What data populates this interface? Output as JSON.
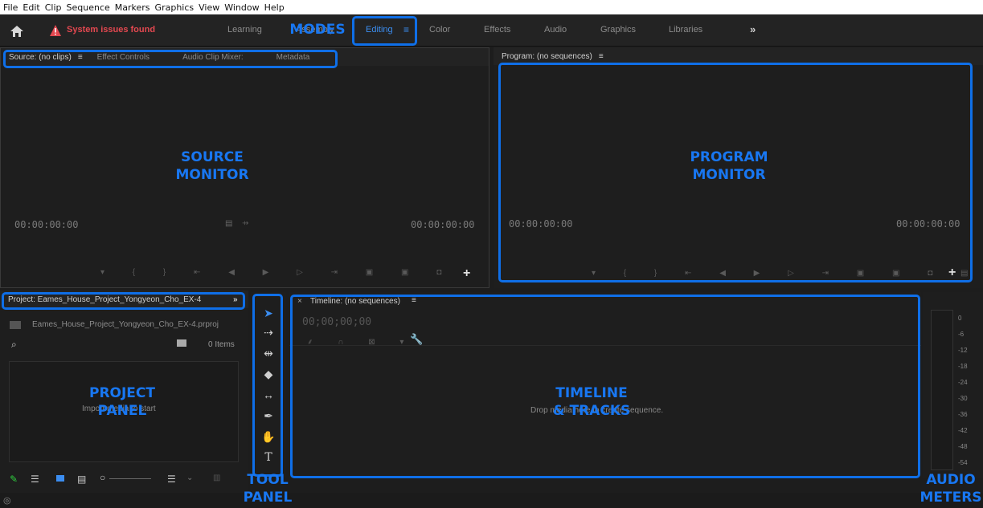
{
  "menu": [
    "File",
    "Edit",
    "Clip",
    "Sequence",
    "Markers",
    "Graphics",
    "View",
    "Window",
    "Help"
  ],
  "header": {
    "home_icon": "home-icon",
    "warning_text": "System issues found",
    "workspaces": [
      "Learning",
      "Assembly",
      "Editing",
      "Color",
      "Effects",
      "Audio",
      "Graphics",
      "Libraries"
    ],
    "active_workspace": "Editing",
    "overflow": "»"
  },
  "source": {
    "tabs": [
      "Source: (no clips)",
      "Effect Controls",
      "Audio Clip Mixer:",
      "Metadata"
    ],
    "timecode_left": "00:00:00:00",
    "timecode_right": "00:00:00:00"
  },
  "program": {
    "tab": "Program: (no sequences)",
    "timecode_left": "00:00:00:00",
    "timecode_right": "00:00:00:00"
  },
  "project": {
    "tab": "Project: Eames_House_Project_Yongyeon_Cho_EX-4",
    "file": "Eames_House_Project_Yongyeon_Cho_EX-4.prproj",
    "search_placeholder": "",
    "items_count": "0 Items",
    "empty_text": "Import media to start"
  },
  "timeline": {
    "tab": "Timeline: (no sequences)",
    "timecode": "00;00;00;00",
    "empty_text": "Drop media here to create sequence."
  },
  "audio_meter_scale": [
    "0",
    "-6",
    "-12",
    "-18",
    "-24",
    "-30",
    "-36",
    "-42",
    "-48",
    "-54"
  ],
  "annotations": {
    "modes": "MODES",
    "source_monitor": [
      "SOURCE",
      "MONITOR"
    ],
    "program_monitor": [
      "PROGRAM",
      "MONITOR"
    ],
    "project_panel": [
      "PROJECT",
      "PANEL"
    ],
    "timeline_tracks": [
      "TIMELINE",
      "& TRACKS"
    ],
    "tool_panel": [
      "TOOL",
      "PANEL"
    ],
    "audio_meters": [
      "AUDIO",
      "METERS"
    ]
  },
  "colors": {
    "accent": "#3b8df0",
    "annotation": "#1877f2",
    "warning": "#e34850"
  }
}
